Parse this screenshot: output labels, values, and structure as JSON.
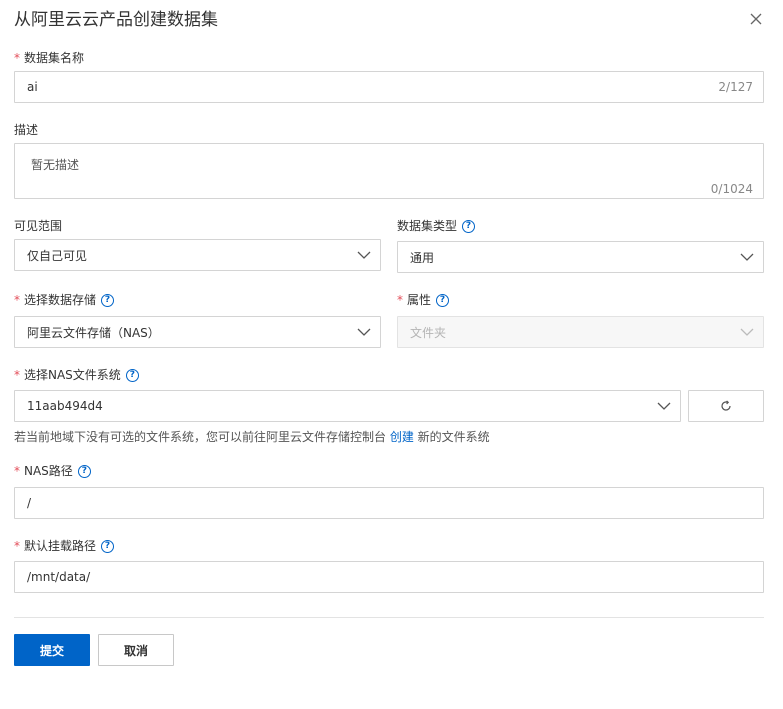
{
  "dialog": {
    "title": "从阿里云云产品创建数据集",
    "close_icon": "close-icon"
  },
  "fields": {
    "name": {
      "label": "数据集名称",
      "required_mark": "*",
      "value": "ai",
      "counter": "2/127"
    },
    "description": {
      "label": "描述",
      "placeholder": "暂无描述",
      "counter": "0/1024"
    },
    "visibility": {
      "label": "可见范围",
      "value": "仅自己可见"
    },
    "dataset_type": {
      "label": "数据集类型",
      "value": "通用"
    },
    "storage": {
      "label": "选择数据存储",
      "required_mark": "*",
      "value": "阿里云文件存储（NAS）"
    },
    "attribute": {
      "label": "属性",
      "required_mark": "*",
      "value": "文件夹"
    },
    "nas_fs": {
      "label": "选择NAS文件系统",
      "required_mark": "*",
      "value": "11aab494d4",
      "hint_before": "若当前地域下没有可选的文件系统，您可以前往阿里云文件存储控制台 ",
      "hint_link": "创建",
      "hint_after": " 新的文件系统"
    },
    "nas_path": {
      "label": "NAS路径",
      "required_mark": "*",
      "value": "/"
    },
    "mount_path": {
      "label": "默认挂载路径",
      "required_mark": "*",
      "value": "/mnt/data/"
    }
  },
  "help_glyph": "?",
  "buttons": {
    "submit": "提交",
    "cancel": "取消"
  },
  "colors": {
    "primary": "#0064c8",
    "required": "#e34d59",
    "border": "#d4d4d4"
  }
}
